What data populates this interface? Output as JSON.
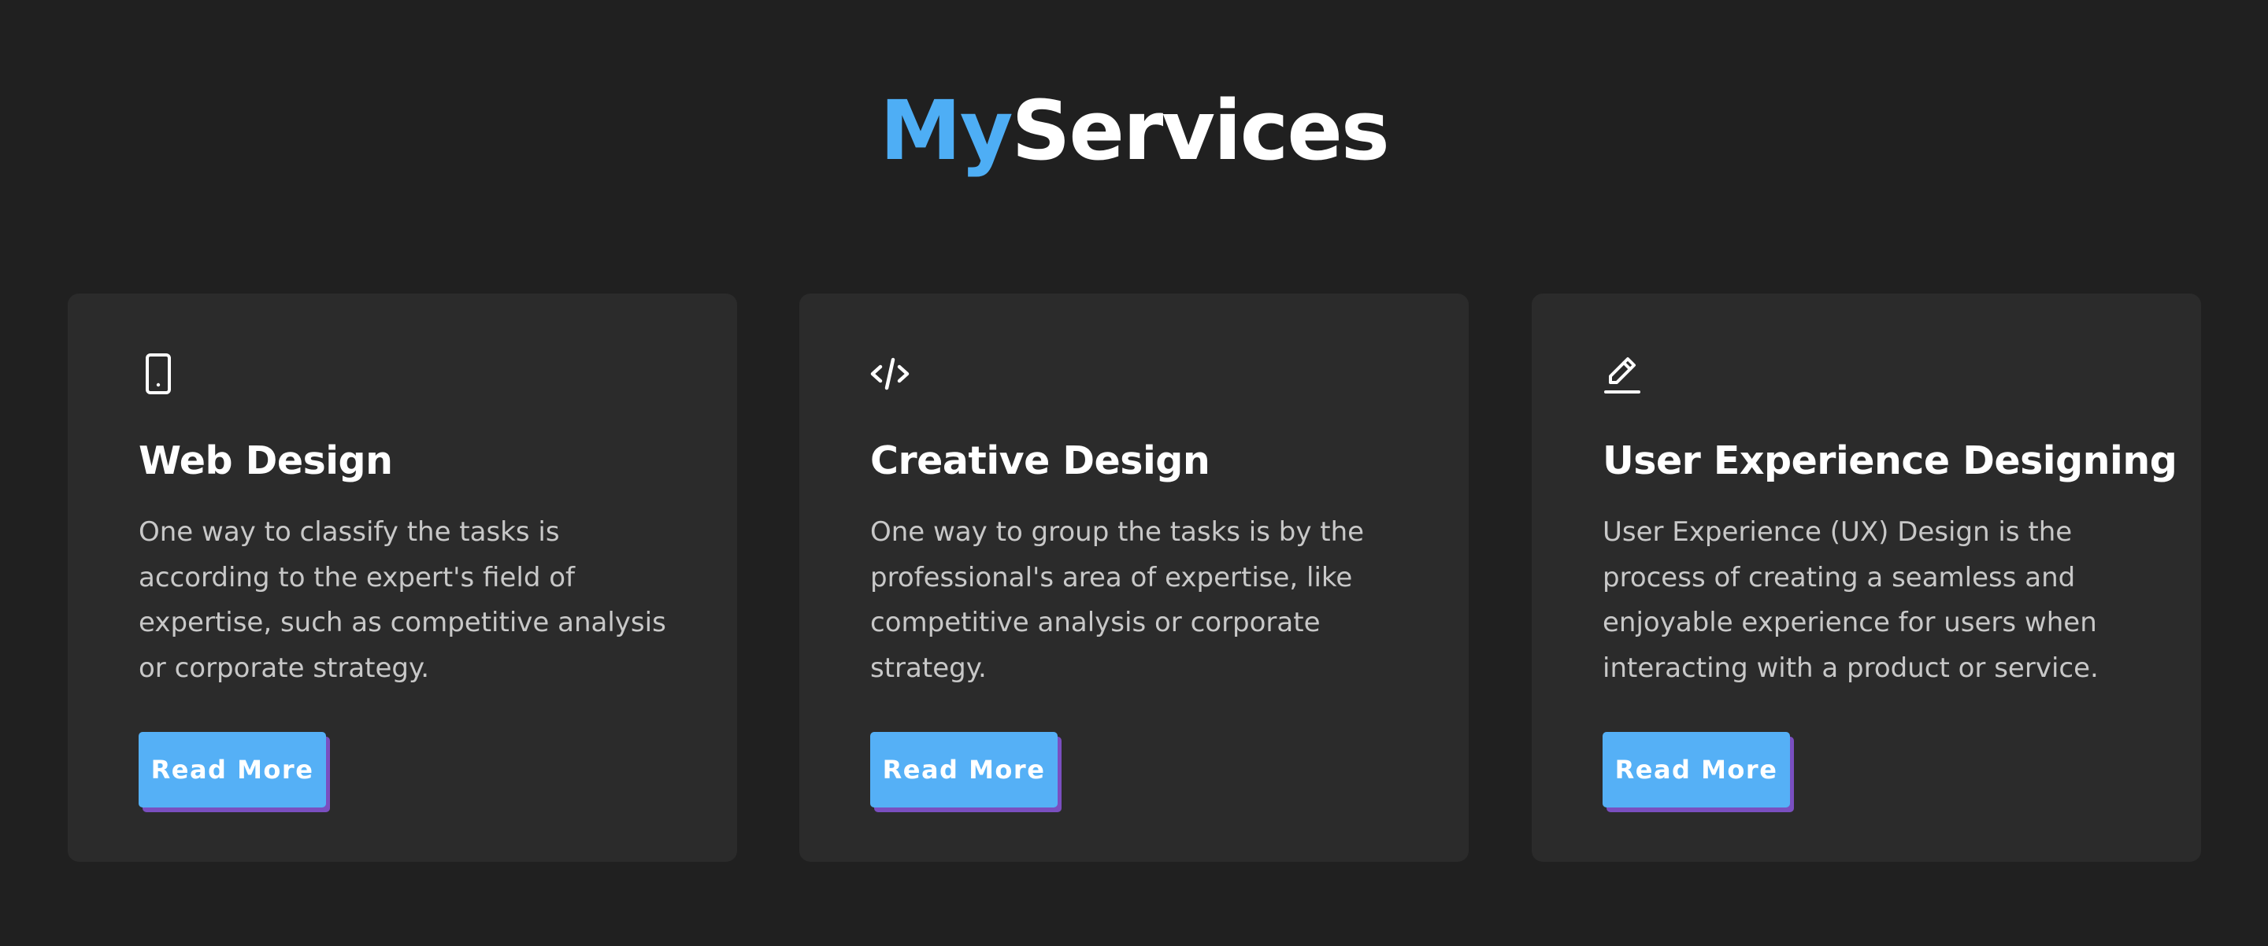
{
  "heading": {
    "accent": "My",
    "main": "Services"
  },
  "colors": {
    "background": "#202020",
    "card": "#2b2b2b",
    "accent": "#4eaef5",
    "button": "#55b0f6",
    "button_shadow": "#7a4fc0",
    "title": "#ffffff",
    "body_text": "#c8c8c8"
  },
  "services": [
    {
      "icon": "tablet-icon",
      "title": "Web Design",
      "description": "One way to classify the tasks is according to the expert's field of expertise, such as competitive analysis or corporate strategy.",
      "button_label": "Read More"
    },
    {
      "icon": "code-icon",
      "title": "Creative Design",
      "description": "One way to group the tasks is by the professional's area of expertise, like competitive analysis or corporate strategy.",
      "button_label": "Read More"
    },
    {
      "icon": "pencil-icon",
      "title": "User Experience Designing",
      "description": "User Experience (UX) Design is the process of creating a seamless and enjoyable experience for users when interacting with a product or service.",
      "button_label": "Read More"
    }
  ]
}
